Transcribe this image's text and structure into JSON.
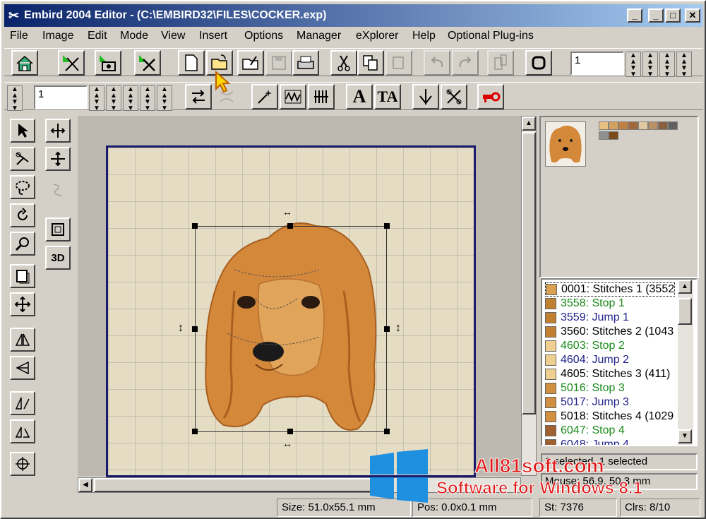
{
  "window": {
    "title": "Embird 2004 Editor - (C:\\EMBIRD32\\FILES\\COCKER.exp)",
    "controls": [
      "_",
      "_",
      "□",
      "✕"
    ]
  },
  "menu": [
    "File",
    "Image",
    "Edit",
    "Mode",
    "View",
    "Insert",
    "Options",
    "Manager",
    "eXplorer",
    "Help",
    "Optional Plug-ins"
  ],
  "toolbar1": {
    "spin_value": "1"
  },
  "toolbar2": {
    "spin_value": "1",
    "text_a": "A",
    "text_ta": "TA"
  },
  "left_tools": {
    "label_3d": "3D"
  },
  "stitch_list": [
    {
      "text": "0001:  Stitches 1 (3552",
      "color": "#000000",
      "swatch": "#d9a050"
    },
    {
      "text": "3558:  Stop 1",
      "color": "#1a8a1a",
      "swatch": "#c08030"
    },
    {
      "text": "3559:  Jump 1",
      "color": "#20208a",
      "swatch": "#c08030"
    },
    {
      "text": "3560:  Stitches 2 (1043",
      "color": "#000000",
      "swatch": "#c08030"
    },
    {
      "text": "4603:  Stop 2",
      "color": "#1a8a1a",
      "swatch": "#f0d090"
    },
    {
      "text": "4604:  Jump 2",
      "color": "#20208a",
      "swatch": "#f0d090"
    },
    {
      "text": "4605:  Stitches 3 (411)",
      "color": "#000000",
      "swatch": "#f0d090"
    },
    {
      "text": "5016:  Stop 3",
      "color": "#1a8a1a",
      "swatch": "#d09040"
    },
    {
      "text": "5017:  Jump 3",
      "color": "#20208a",
      "swatch": "#d09040"
    },
    {
      "text": "5018:  Stitches 4 (1029",
      "color": "#000000",
      "swatch": "#d09040"
    },
    {
      "text": "6047:  Stop 4",
      "color": "#1a8a1a",
      "swatch": "#a06030"
    },
    {
      "text": "6048:  Jump 4",
      "color": "#20208a",
      "swatch": "#a06030"
    }
  ],
  "palette": [
    "#e8c080",
    "#d4a060",
    "#c08040",
    "#a06838",
    "#e0c8a0",
    "#b89068",
    "#886040",
    "#606060",
    "#909090",
    "#7a4a18"
  ],
  "info": {
    "selected": "1 selected, 1 selected",
    "mouse": "Mouse: 56.9, 50.3 mm"
  },
  "status": {
    "size": "Size: 51.0x55.1 mm",
    "pos": "Pos: 0.0x0.1 mm",
    "st": "St: 7376",
    "clrs": "Clrs: 8/10"
  },
  "watermark": {
    "brand": "All81soft.com",
    "tagline": "Software for Windows 8.1"
  }
}
